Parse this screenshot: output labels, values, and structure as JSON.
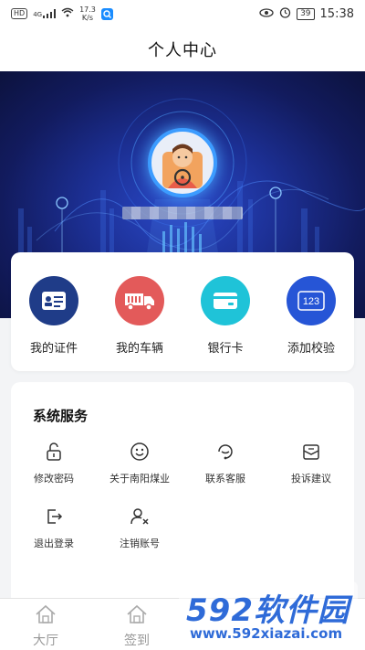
{
  "status_bar": {
    "left_badge": "HD",
    "signal": "4G",
    "speed_value": "17.3",
    "speed_unit": "K/s",
    "battery": "39",
    "time": "15:38"
  },
  "header": {
    "title": "个人中心"
  },
  "profile": {
    "name_masked": ""
  },
  "quick_menu": [
    {
      "label": "我的证件",
      "icon": "id-card-icon",
      "color": "#1f3c88"
    },
    {
      "label": "我的车辆",
      "icon": "truck-icon",
      "color": "#e35a5a"
    },
    {
      "label": "银行卡",
      "icon": "bank-card-icon",
      "color": "#1fc3d8"
    },
    {
      "label": "添加校验",
      "icon": "verify-123-icon",
      "color": "#2655d6"
    }
  ],
  "services": {
    "title": "系统服务",
    "items": [
      {
        "label": "修改密码",
        "icon": "lock-icon"
      },
      {
        "label": "关于南阳煤业",
        "icon": "smile-icon"
      },
      {
        "label": "联系客服",
        "icon": "customer-service-icon"
      },
      {
        "label": "投诉建议",
        "icon": "feedback-icon"
      },
      {
        "label": "退出登录",
        "icon": "logout-icon"
      },
      {
        "label": "注销账号",
        "icon": "delete-account-icon"
      }
    ]
  },
  "bottom_nav": [
    {
      "label": "大厅",
      "icon": "home-icon"
    },
    {
      "label": "签到",
      "icon": "home-icon"
    }
  ],
  "watermark": {
    "logo": "592软件园",
    "url": "www.592xiazai.com"
  }
}
